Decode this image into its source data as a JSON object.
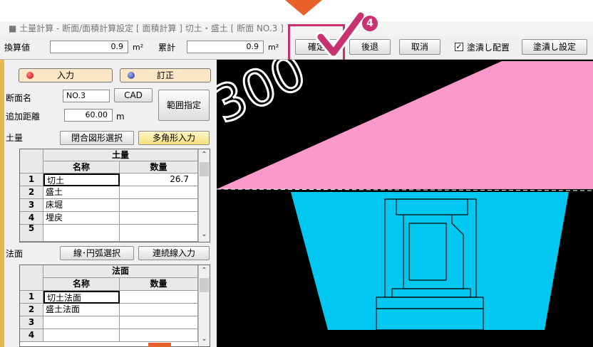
{
  "annotation": {
    "step_badge": "4"
  },
  "title": {
    "text": "■ 土量計算 - 断面/面積計算設定 [ 面積計算 ] 切土・盛土 [ 断面 NO.3 ]"
  },
  "toolbar": {
    "converted_label": "換算値",
    "converted_value": "0.9",
    "converted_unit": "m²",
    "cumulative_label": "累計",
    "cumulative_value": "0.9",
    "cumulative_unit": "m²",
    "confirm_label": "確定",
    "back_label": "後退",
    "cancel_label": "取消",
    "fill_place_checked": true,
    "fill_place_label": "塗潰し配置",
    "fill_settings_label": "塗潰し設定"
  },
  "panel": {
    "input_mode_label": "入力",
    "correction_mode_label": "訂正",
    "section_name_label": "断面名",
    "section_name_value": "NO.3",
    "cad_label": "CAD",
    "range_label": "範囲指定",
    "added_distance_label": "追加距離",
    "added_distance_value": "60.00",
    "added_distance_unit": "m",
    "soil_label": "土量",
    "closed_shape_label": "閉合図形選択",
    "polygon_input_label": "多角形入力",
    "slope_label": "法面",
    "line_arc_label": "線･円弧選択",
    "continuous_line_label": "連続線入力"
  },
  "soil_table": {
    "group_header": "土量",
    "col_name": "名称",
    "col_qty": "数量",
    "rows": [
      {
        "no": "1",
        "name": "切土",
        "qty": "26.7"
      },
      {
        "no": "2",
        "name": "盛土",
        "qty": ""
      },
      {
        "no": "3",
        "name": "床堀",
        "qty": ""
      },
      {
        "no": "4",
        "name": "埋戻",
        "qty": ""
      },
      {
        "no": "5",
        "name": "",
        "qty": ""
      }
    ]
  },
  "slope_table": {
    "group_header": "法面",
    "col_name": "名称",
    "col_qty": "数量",
    "rows": [
      {
        "no": "1",
        "name": "切土法面",
        "qty": ""
      },
      {
        "no": "2",
        "name": "盛土法面",
        "qty": ""
      },
      {
        "no": "3",
        "name": "",
        "qty": ""
      },
      {
        "no": "4",
        "name": "",
        "qty": ""
      }
    ]
  },
  "canvas": {
    "dimension_text": "300",
    "cut_color": "#f99acb",
    "fill_color": "#00c8f0",
    "structure_color": "#000000"
  },
  "colors": {
    "accent_annotation": "#c8326e",
    "arrow": "#e8602c",
    "input_dot": "#e01010",
    "correction_dot": "#3355aa",
    "mode_button_bg": "#fbe7c6"
  }
}
